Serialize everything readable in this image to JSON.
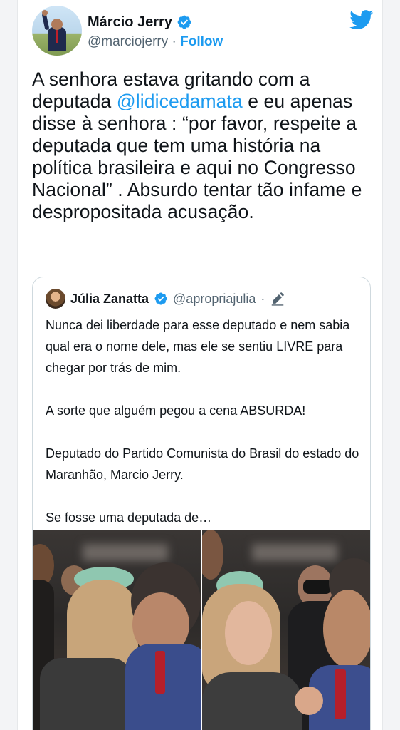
{
  "tweet": {
    "author_name": "Márcio Jerry",
    "author_handle": "@marciojerry",
    "separator": " · ",
    "follow_label": "Follow",
    "text_part1": "A senhora estava gritando com a deputada ",
    "mention": "@lidicedamata",
    "text_part2": " e eu apenas disse à senhora : “por favor, respeite a deputada que tem uma história na política brasileira e aqui no Congresso Nacional” . Absurdo tentar tão infame e despropositada acusação."
  },
  "quoted_tweet": {
    "author_name": "Júlia Zanatta",
    "author_handle": "@apropriajulia",
    "separator": " · ",
    "paragraphs": [
      "Nunca dei liberdade para esse deputado e nem sabia qual era o nome dele, mas ele se sentiu LIVRE para chegar por trás de mim.",
      "A sorte que alguém pegou a cena ABSURDA!",
      "Deputado do Partido Comunista do Brasil do estado do Maranhão, Marcio Jerry.",
      "Se fosse uma deputada de…"
    ]
  },
  "icons": [
    "verified-badge-icon",
    "twitter-bird-icon",
    "edit-pen-icon"
  ],
  "colors": {
    "accent": "#1d9bf0",
    "text": "#0f1419",
    "muted": "#536471",
    "border": "#cfd9de"
  }
}
